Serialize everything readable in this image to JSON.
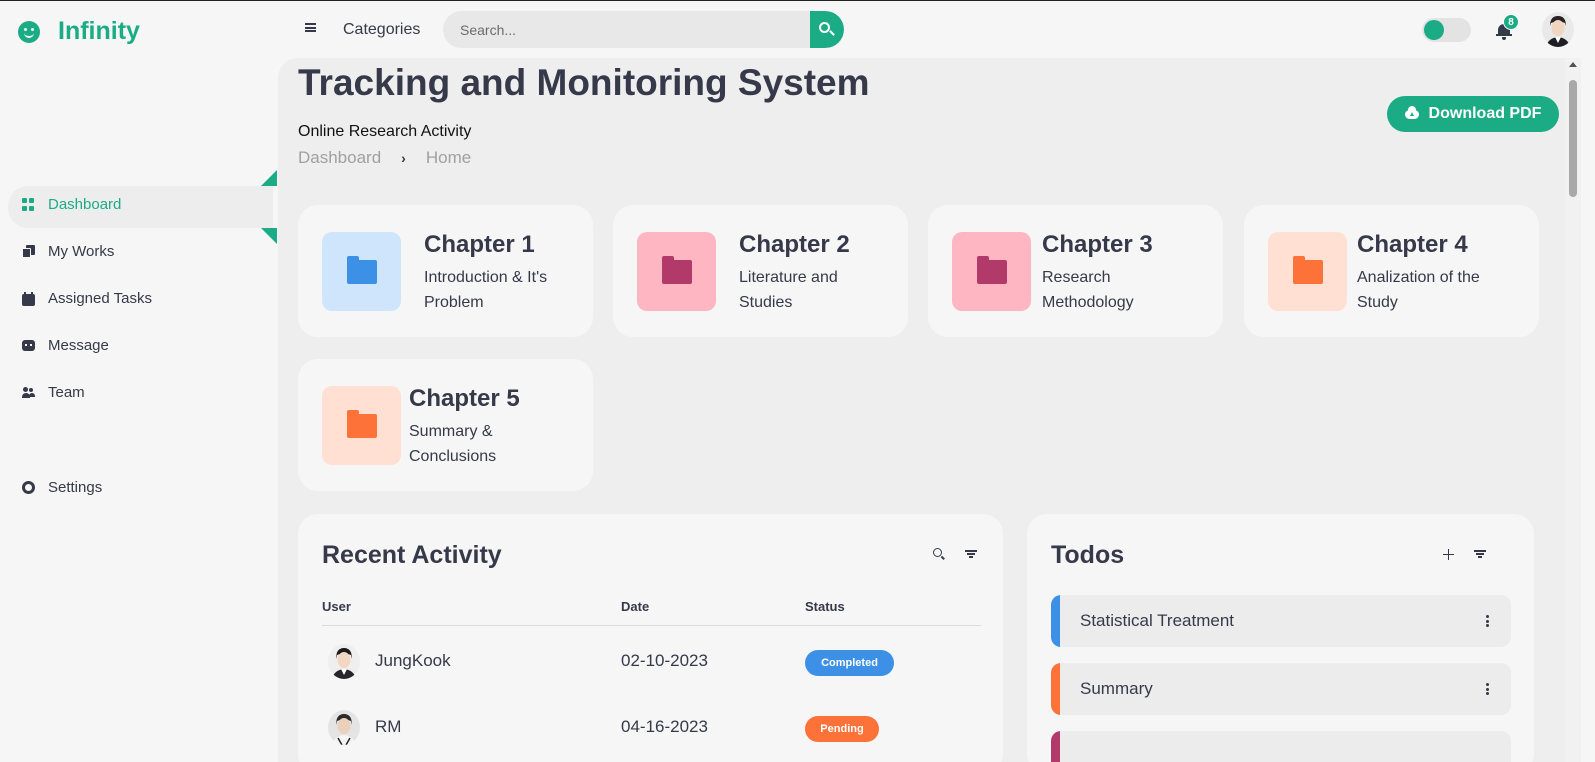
{
  "brand": {
    "name": "Infinity"
  },
  "topbar": {
    "categories_label": "Categories",
    "search_placeholder": "Search...",
    "notifications_count": "8",
    "theme_toggle_on": true
  },
  "sidebar": {
    "items": [
      {
        "label": "Dashboard",
        "icon": "dashboard-icon",
        "active": true
      },
      {
        "label": "My Works",
        "icon": "copy-icon"
      },
      {
        "label": "Assigned Tasks",
        "icon": "calendar-icon"
      },
      {
        "label": "Message",
        "icon": "message-icon"
      },
      {
        "label": "Team",
        "icon": "team-icon"
      }
    ],
    "settings_label": "Settings"
  },
  "header": {
    "title": "Tracking and Monitoring System",
    "subtitle": "Online Research Activity",
    "breadcrumb": [
      "Dashboard",
      "Home"
    ],
    "download_label": "Download PDF"
  },
  "chapters": [
    {
      "title": "Chapter 1",
      "desc": "Introduction & It's Problem",
      "bg": "#cfe5fb",
      "fg": "#3c91e6"
    },
    {
      "title": "Chapter 2",
      "desc": "Literature and Studies",
      "bg": "#ffb6c3",
      "fg": "#b23a6b"
    },
    {
      "title": "Chapter 3",
      "desc": "Research Methodology",
      "bg": "#ffb6c3",
      "fg": "#b23a6b"
    },
    {
      "title": "Chapter 4",
      "desc": "Analization of the Study",
      "bg": "#ffe0d3",
      "fg": "#fd7238"
    },
    {
      "title": "Chapter 5",
      "desc": "Summary & Conclusions",
      "bg": "#ffe0d3",
      "fg": "#fd7238"
    }
  ],
  "recent_activity": {
    "title": "Recent Activity",
    "columns": [
      "User",
      "Date",
      "Status"
    ],
    "rows": [
      {
        "user": "JungKook",
        "date": "02-10-2023",
        "status": "Completed",
        "status_color": "#3c91e6"
      },
      {
        "user": "RM",
        "date": "04-16-2023",
        "status": "Pending",
        "status_color": "#fd7238"
      }
    ]
  },
  "todos": {
    "title": "Todos",
    "items": [
      {
        "label": "Statistical Treatment",
        "color": "#3c91e6"
      },
      {
        "label": "Summary",
        "color": "#fd7238"
      },
      {
        "label": "",
        "color": "#b23a6b"
      }
    ]
  },
  "colors": {
    "accent": "#1bac86",
    "dark": "#363949",
    "blue": "#3c91e6",
    "orange": "#fd7238",
    "pink": "#b23a6b"
  }
}
